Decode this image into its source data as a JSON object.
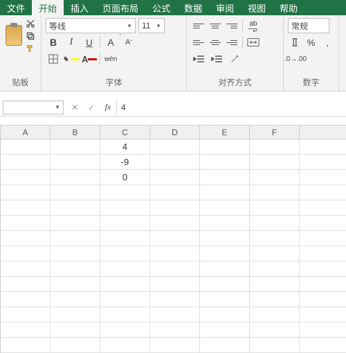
{
  "tabs": [
    "文件",
    "开始",
    "插入",
    "页面布局",
    "公式",
    "数据",
    "审阅",
    "视图",
    "帮助"
  ],
  "activeTab": 1,
  "clipboard": {
    "title": "贴板"
  },
  "font": {
    "name": "等线",
    "size": "11",
    "bold": "B",
    "italic": "I",
    "underline": "U",
    "wen": "wén",
    "title": "字体",
    "bigA": "A",
    "smallA": "A"
  },
  "align": {
    "title": "对齐方式",
    "wrap": "ab"
  },
  "number": {
    "title": "数字",
    "format": "常规"
  },
  "namebox": "",
  "formulaValue": "4",
  "columns": [
    "A",
    "B",
    "C",
    "D",
    "E",
    "F",
    ""
  ],
  "cells": {
    "C1": "4",
    "C2": "-9",
    "C3": "0"
  },
  "rowCount": 14
}
